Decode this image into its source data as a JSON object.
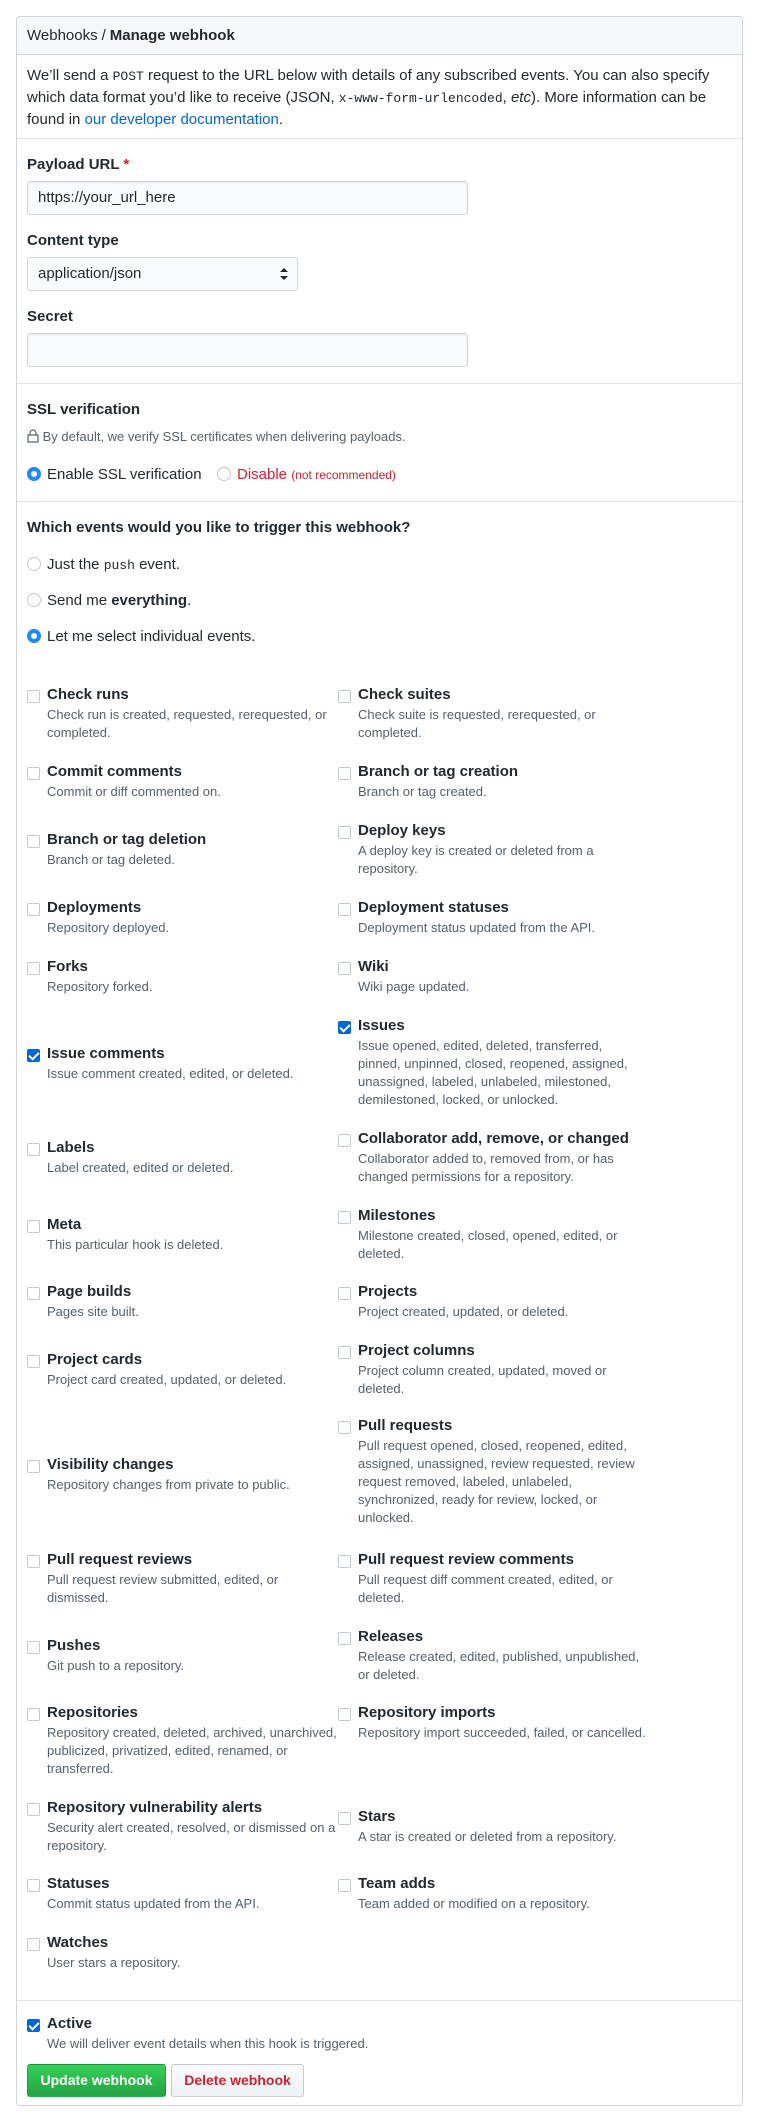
{
  "header": {
    "breadcrumb_parent": "Webhooks",
    "separator": "/",
    "title": "Manage webhook"
  },
  "intro": {
    "part1": "We’ll send a ",
    "code1": "POST",
    "part2": " request to the URL below with details of any subscribed events. You can also specify which data format you’d like to receive (JSON, ",
    "code2": "x-www-form-urlencoded",
    "part3": ", ",
    "etc": "etc",
    "part4": "). More information can be found in ",
    "link": "our developer documentation",
    "part5": "."
  },
  "payload_url": {
    "label": "Payload URL",
    "required_mark": "*",
    "value": "https://your_url_here"
  },
  "content_type": {
    "label": "Content type",
    "value": "application/json"
  },
  "secret": {
    "label": "Secret",
    "value": ""
  },
  "ssl": {
    "label": "SSL verification",
    "note": "By default, we verify SSL certificates when delivering payloads.",
    "enable_label": "Enable SSL verification",
    "disable_label": "Disable",
    "disable_note": "(not recommended)"
  },
  "events": {
    "question": "Which events would you like to trigger this webhook?",
    "opt_push_a": "Just the ",
    "opt_push_code": "push",
    "opt_push_b": " event.",
    "opt_all_a": "Send me ",
    "opt_all_b": "everything",
    "opt_all_c": ".",
    "opt_individual": "Let me select individual events.",
    "list": [
      {
        "title": "Check runs",
        "desc": "Check run is created, requested, rerequested, or completed.",
        "checked": false
      },
      {
        "title": "Check suites",
        "desc": "Check suite is requested, rerequested, or completed.",
        "checked": false
      },
      {
        "title": "Commit comments",
        "desc": "Commit or diff commented on.",
        "checked": false
      },
      {
        "title": "Branch or tag creation",
        "desc": "Branch or tag created.",
        "checked": false
      },
      {
        "title": "Branch or tag deletion",
        "desc": "Branch or tag deleted.",
        "checked": false
      },
      {
        "title": "Deploy keys",
        "desc": "A deploy key is created or deleted from a repository.",
        "checked": false
      },
      {
        "title": "Deployments",
        "desc": "Repository deployed.",
        "checked": false
      },
      {
        "title": "Deployment statuses",
        "desc": "Deployment status updated from the API.",
        "checked": false
      },
      {
        "title": "Forks",
        "desc": "Repository forked.",
        "checked": false
      },
      {
        "title": "Wiki",
        "desc": "Wiki page updated.",
        "checked": false
      },
      {
        "title": "Issue comments",
        "desc": "Issue comment created, edited, or deleted.",
        "checked": true
      },
      {
        "title": "Issues",
        "desc": "Issue opened, edited, deleted, transferred, pinned, unpinned, closed, reopened, assigned, unassigned, labeled, unlabeled, milestoned, demilestoned, locked, or unlocked.",
        "checked": true
      },
      {
        "title": "Labels",
        "desc": "Label created, edited or deleted.",
        "checked": false
      },
      {
        "title": "Collaborator add, remove, or changed",
        "desc": "Collaborator added to, removed from, or has changed permissions for a repository.",
        "checked": false
      },
      {
        "title": "Meta",
        "desc": "This particular hook is deleted.",
        "checked": false
      },
      {
        "title": "Milestones",
        "desc": "Milestone created, closed, opened, edited, or deleted.",
        "checked": false
      },
      {
        "title": "Page builds",
        "desc": "Pages site built.",
        "checked": false
      },
      {
        "title": "Projects",
        "desc": "Project created, updated, or deleted.",
        "checked": false
      },
      {
        "title": "Project cards",
        "desc": "Project card created, updated, or deleted.",
        "checked": false
      },
      {
        "title": "Project columns",
        "desc": "Project column created, updated, moved or deleted.",
        "checked": false
      },
      {
        "title": "Visibility changes",
        "desc": "Repository changes from private to public.",
        "checked": false
      },
      {
        "title": "Pull requests",
        "desc": "Pull request opened, closed, reopened, edited, assigned, unassigned, review requested, review request removed, labeled, unlabeled, synchronized, ready for review, locked, or unlocked.",
        "checked": false
      },
      {
        "title": "Pull request reviews",
        "desc": "Pull request review submitted, edited, or dismissed.",
        "checked": false
      },
      {
        "title": "Pull request review comments",
        "desc": "Pull request diff comment created, edited, or deleted.",
        "checked": false
      },
      {
        "title": "Pushes",
        "desc": "Git push to a repository.",
        "checked": false
      },
      {
        "title": "Releases",
        "desc": "Release created, edited, published, unpublished, or deleted.",
        "checked": false
      },
      {
        "title": "Repositories",
        "desc": "Repository created, deleted, archived, unarchived, publicized, privatized, edited, renamed, or transferred.",
        "checked": false
      },
      {
        "title": "Repository imports",
        "desc": "Repository import succeeded, failed, or cancelled.",
        "checked": false
      },
      {
        "title": "Repository vulnerability alerts",
        "desc": "Security alert created, resolved, or dismissed on a repository.",
        "checked": false
      },
      {
        "title": "Stars",
        "desc": "A star is created or deleted from a repository.",
        "checked": false
      },
      {
        "title": "Statuses",
        "desc": "Commit status updated from the API.",
        "checked": false
      },
      {
        "title": "Team adds",
        "desc": "Team added or modified on a repository.",
        "checked": false
      },
      {
        "title": "Watches",
        "desc": "User stars a repository.",
        "checked": false
      }
    ]
  },
  "active": {
    "label": "Active",
    "desc": "We will deliver event details when this hook is triggered."
  },
  "actions": {
    "update_label": "Update webhook",
    "delete_label": "Delete webhook"
  },
  "colors": {
    "primary": "#28a745",
    "danger": "#cb2431",
    "link": "#0366d6",
    "radio_on": "#2188ff"
  }
}
